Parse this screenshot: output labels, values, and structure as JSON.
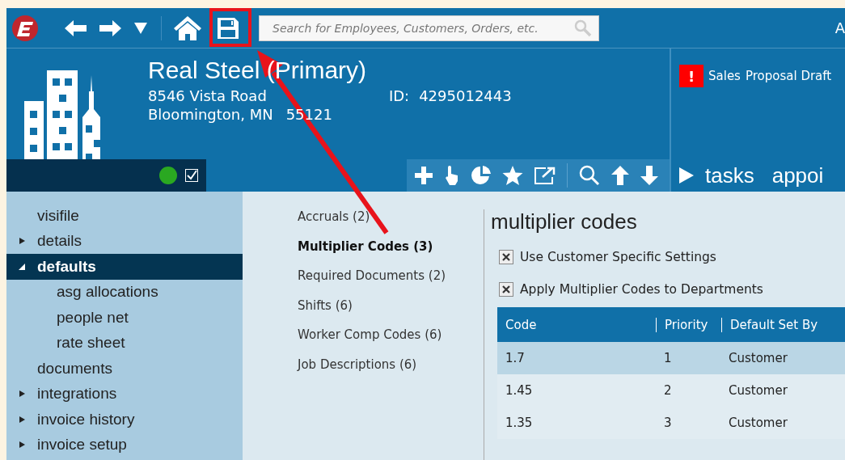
{
  "topbar": {
    "search": {
      "placeholder": "Search for Employees, Customers, Orders, etc."
    },
    "user_initial": "A"
  },
  "header": {
    "name": "Real Steel (Primary)",
    "address_line_1": "8546 Vista Road",
    "address_line_2": "Bloomington, MN",
    "zip": "55121",
    "id_label": "ID:",
    "id_value": "4295012443",
    "status_checked": true
  },
  "alert": {
    "badge": "!",
    "category": "Sales",
    "text": "Proposal Draft"
  },
  "tabs": [
    {
      "label": "tasks"
    },
    {
      "label": "appoi"
    }
  ],
  "sidebar": {
    "items": [
      {
        "label": "visifile",
        "selected": false
      },
      {
        "label": "details",
        "selected": false,
        "expanded": false
      },
      {
        "label": "defaults",
        "selected": true,
        "expanded": true,
        "children": [
          {
            "label": "asg allocations",
            "selected": false
          },
          {
            "label": "people net",
            "selected": false
          },
          {
            "label": "rate sheet",
            "selected": false
          }
        ]
      },
      {
        "label": "documents",
        "selected": false
      },
      {
        "label": "integrations",
        "selected": false,
        "expanded": false
      },
      {
        "label": "invoice history",
        "selected": false,
        "expanded": false
      },
      {
        "label": "invoice setup",
        "selected": false,
        "expanded": false
      }
    ]
  },
  "sections": [
    {
      "label": "Accruals (2)",
      "selected": false
    },
    {
      "label": "Multiplier Codes (3)",
      "selected": true
    },
    {
      "label": "Required Documents (2)",
      "selected": false
    },
    {
      "label": "Shifts (6)",
      "selected": false
    },
    {
      "label": "Worker Comp Codes (6)",
      "selected": false
    },
    {
      "label": "Job Descriptions (6)",
      "selected": false
    }
  ],
  "panel": {
    "title": "multiplier codes",
    "options": [
      {
        "label": "Use Customer Specific Settings",
        "checked": true
      },
      {
        "label": "Apply Multiplier Codes to Departments",
        "checked": true
      }
    ],
    "table": {
      "columns": [
        "Code",
        "Priority",
        "Default Set By"
      ],
      "rows": [
        {
          "cells": [
            "1.7",
            "1",
            "Customer"
          ],
          "selected": true
        },
        {
          "cells": [
            "1.45",
            "2",
            "Customer"
          ],
          "selected": false
        },
        {
          "cells": [
            "1.35",
            "3",
            "Customer"
          ],
          "selected": false
        }
      ]
    }
  }
}
